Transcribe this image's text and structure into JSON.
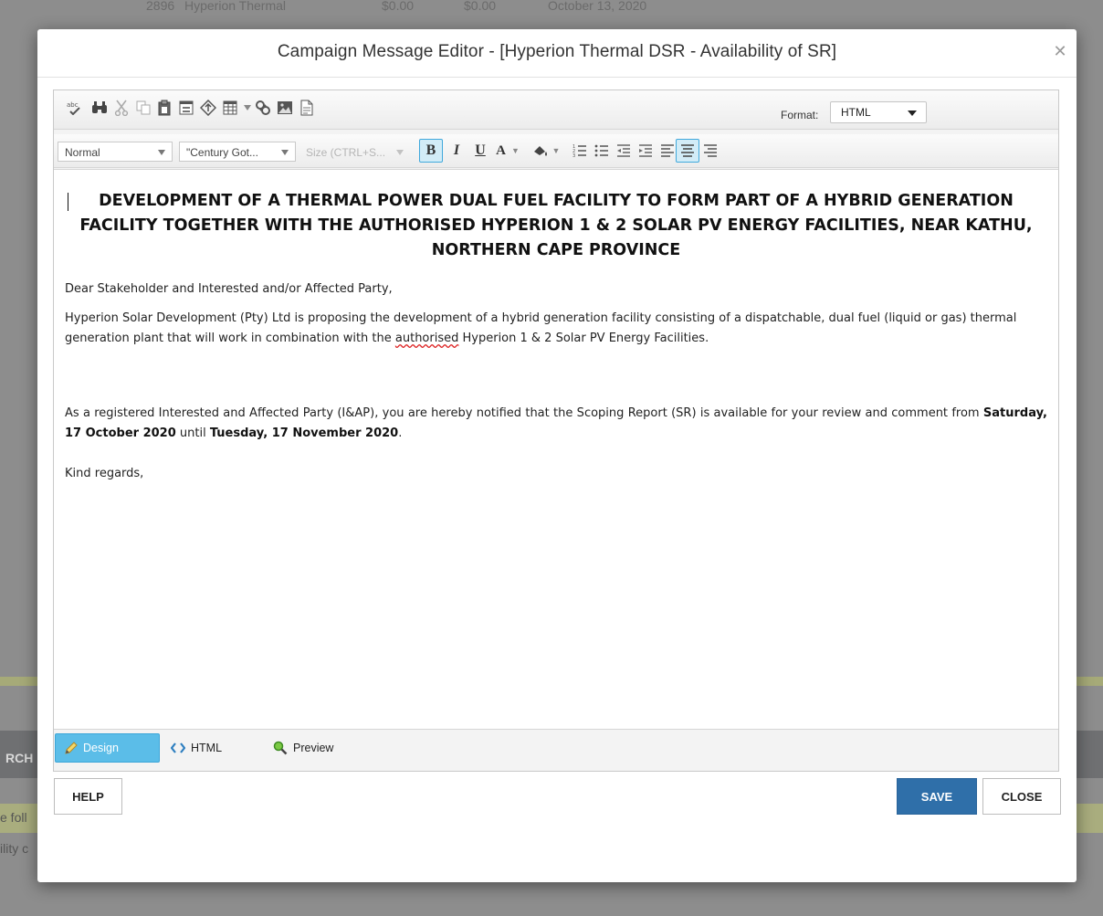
{
  "background": {
    "rows": [
      {
        "id": "2896",
        "name": "Hyperion Thermal",
        "v1": "$0.00",
        "v2": "$0.00",
        "date": "October 13, 2020"
      }
    ],
    "side_text": [
      "RCH",
      "e foll",
      "ility c"
    ]
  },
  "modal": {
    "title": "Campaign Message Editor - [Hyperion Thermal DSR - Availability of SR]",
    "close_icon": "close-icon"
  },
  "toolbar": {
    "icons": [
      "spellcheck-icon",
      "find-icon",
      "cut-icon",
      "copy-icon",
      "paste-icon",
      "form-icon",
      "anchor-icon",
      "table-icon",
      "link-icon",
      "image-icon",
      "document-icon"
    ],
    "format_label": "Format:",
    "format_value": "HTML",
    "paragraph_style": "Normal",
    "font_name": "\"Century Got...",
    "font_size": "Size (CTRL+S..."
  },
  "document": {
    "heading": "DEVELOPMENT OF A THERMAL POWER DUAL FUEL FACILITY TO FORM PART OF A HYBRID GENERATION FACILITY TOGETHER WITH THE AUTHORISED HYPERION 1 & 2 SOLAR PV ENERGY FACILITIES, NEAR KATHU, NORTHERN CAPE PROVINCE",
    "salutation": "Dear Stakeholder and Interested and/or Affected Party,",
    "p1_before": "Hyperion Solar Development (Pty) Ltd is proposing the development of a hybrid generation facility consisting of a dispatchable, dual fuel (liquid or gas) thermal generation plant that will work in combination with the ",
    "p1_flagged": "authorised",
    "p1_after": " Hyperion 1 & 2 Solar PV Energy Facilities.",
    "p2_before": "As a registered Interested and Affected Party (I&AP), you are hereby notified that the Scoping Report (SR) is available for your review and comment from ",
    "p2_date1": "Saturday, 17 October 2020",
    "p2_mid": " until ",
    "p2_date2": "Tuesday, 17 November 2020",
    "p2_end": ".",
    "closing": "Kind regards,"
  },
  "modes": {
    "design": "Design",
    "html": "HTML",
    "preview": "Preview"
  },
  "footer": {
    "help": "HELP",
    "save": "SAVE",
    "close": "CLOSE"
  },
  "colors": {
    "save_button": "#2f6fa9",
    "active_tab": "#5bbde8",
    "active_format_button": "#d2ecf7"
  }
}
